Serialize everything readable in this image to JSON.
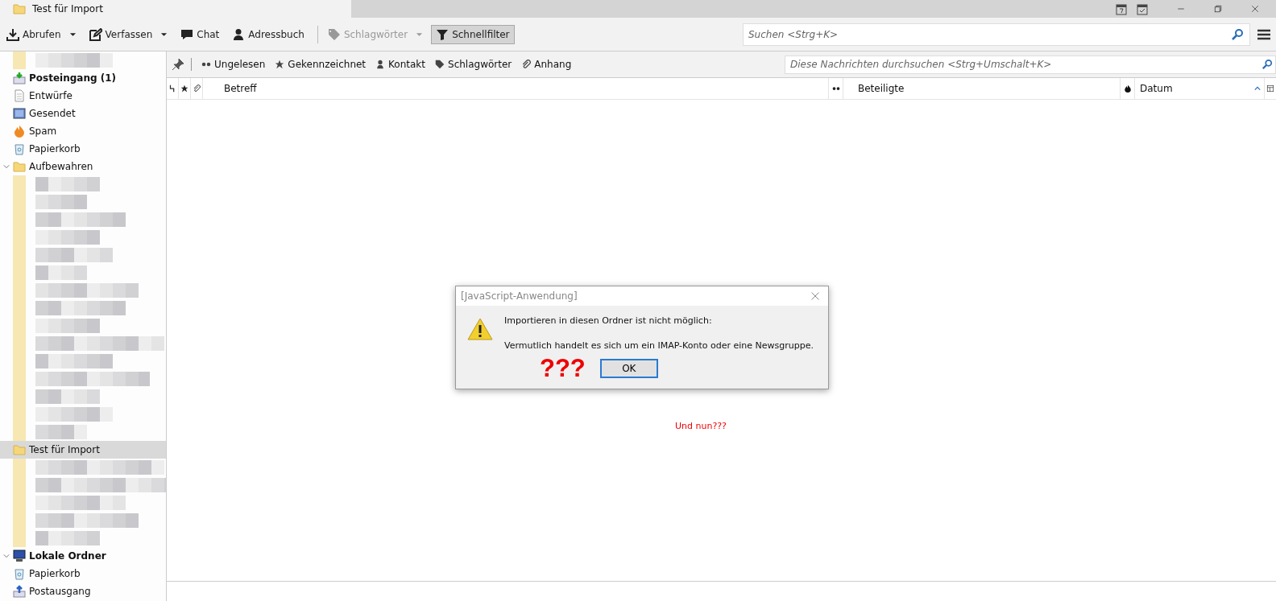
{
  "window": {
    "tab_title": "Test für Import"
  },
  "toolbar": {
    "buttons": [
      {
        "kind": "download",
        "label": "Abrufen",
        "menu": true,
        "disabled": false,
        "selected": false
      },
      {
        "kind": "compose",
        "label": "Verfassen",
        "menu": true,
        "disabled": false,
        "selected": false
      },
      {
        "kind": "chat",
        "label": "Chat",
        "menu": false,
        "disabled": false,
        "selected": false
      },
      {
        "kind": "person",
        "label": "Adressbuch",
        "menu": false,
        "disabled": false,
        "selected": false
      },
      {
        "kind": "tag",
        "label": "Schlagwörter",
        "menu": true,
        "disabled": true,
        "selected": false
      },
      {
        "kind": "filter",
        "label": "Schnellfilter",
        "menu": false,
        "disabled": false,
        "selected": true
      }
    ],
    "search": {
      "placeholder": "Suchen <Strg+K>"
    }
  },
  "sidebar": {
    "items": [
      {
        "kind": "redacted"
      },
      {
        "kind": "inbox",
        "label": "Posteingang (1)",
        "bold": true,
        "selected": false
      },
      {
        "kind": "drafts",
        "label": "Entwürfe",
        "bold": false,
        "selected": false
      },
      {
        "kind": "sent",
        "label": "Gesendet",
        "bold": false,
        "selected": false
      },
      {
        "kind": "spam",
        "label": "Spam",
        "bold": false,
        "selected": false
      },
      {
        "kind": "trash",
        "label": "Papierkorb",
        "bold": false,
        "selected": false
      },
      {
        "kind": "folder",
        "label": "Aufbewahren",
        "bold": false,
        "selected": false,
        "expanded": true
      },
      {
        "kind": "redacted"
      },
      {
        "kind": "redacted"
      },
      {
        "kind": "redacted"
      },
      {
        "kind": "redacted"
      },
      {
        "kind": "redacted"
      },
      {
        "kind": "redacted"
      },
      {
        "kind": "redacted"
      },
      {
        "kind": "redacted"
      },
      {
        "kind": "redacted"
      },
      {
        "kind": "redacted"
      },
      {
        "kind": "redacted"
      },
      {
        "kind": "redacted"
      },
      {
        "kind": "redacted"
      },
      {
        "kind": "redacted"
      },
      {
        "kind": "redacted"
      },
      {
        "kind": "folder",
        "label": "Test für Import",
        "bold": false,
        "selected": true
      },
      {
        "kind": "redacted"
      },
      {
        "kind": "redacted"
      },
      {
        "kind": "redacted"
      },
      {
        "kind": "redacted"
      },
      {
        "kind": "redacted"
      },
      {
        "kind": "computer",
        "label": "Lokale Ordner",
        "bold": true,
        "selected": false,
        "expanded": true
      },
      {
        "kind": "trash",
        "label": "Papierkorb",
        "bold": false,
        "selected": false
      },
      {
        "kind": "outbox",
        "label": "Postausgang",
        "bold": false,
        "selected": false
      }
    ]
  },
  "quick_filter": {
    "filters": [
      {
        "kind": "unread",
        "label": "Ungelesen",
        "selected": false
      },
      {
        "kind": "star",
        "label": "Gekennzeichnet",
        "selected": false
      },
      {
        "kind": "person",
        "label": "Kontakt",
        "selected": false
      },
      {
        "kind": "tag",
        "label": "Schlagwörter",
        "selected": false
      },
      {
        "kind": "clip",
        "label": "Anhang",
        "selected": false
      }
    ],
    "search": {
      "placeholder": "Diese Nachrichten durchsuchen <Strg+Umschalt+K>"
    }
  },
  "table": {
    "columns": [
      {
        "kind": "subject",
        "label": "Betreff"
      },
      {
        "kind": "correspondents",
        "label": "Beteiligte"
      },
      {
        "kind": "date",
        "label": "Datum"
      }
    ]
  },
  "dialog": {
    "title": "[JavaScript-Anwendung]",
    "message": "Importieren in diesen Ordner ist nicht möglich:",
    "detail": "Vermutlich handelt es sich um ein IMAP-Konto oder eine Newsgruppe.",
    "annotation": "???",
    "ok_button": "OK"
  },
  "annotation": "Und nun???"
}
